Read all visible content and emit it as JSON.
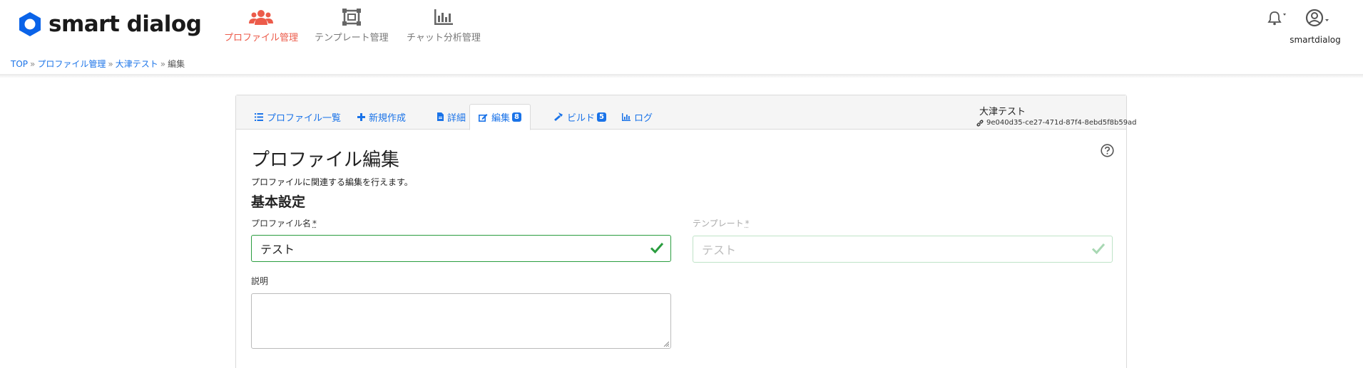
{
  "brand": {
    "name": "smart dialog",
    "color": "#0a63e8"
  },
  "nav": [
    {
      "label": "プロファイル管理",
      "icon": "users-icon",
      "active": true
    },
    {
      "label": "テンプレート管理",
      "icon": "template-frame-icon",
      "active": false
    },
    {
      "label": "チャット分析管理",
      "icon": "bar-chart-icon",
      "active": false
    }
  ],
  "user": {
    "name": "smartdialog",
    "icon": "user-circle-icon"
  },
  "notifications": {
    "icon": "bell-icon"
  },
  "breadcrumb": [
    "TOP",
    "プロファイル管理",
    "大津テスト",
    "編集"
  ],
  "tabs": [
    {
      "label": "プロファイル一覧",
      "icon": "list-icon"
    },
    {
      "label": "新規作成",
      "icon": "plus-icon"
    },
    {
      "label": "詳細",
      "icon": "file-icon"
    },
    {
      "label": "編集",
      "icon": "edit-icon",
      "badge": "8",
      "active": true
    },
    {
      "label": "ビルド",
      "icon": "hammer-icon",
      "badge": "5"
    },
    {
      "label": "ログ",
      "icon": "chart-icon"
    }
  ],
  "record": {
    "name": "大津テスト",
    "id": "9e040d35-ce27-471d-87f4-8ebd5f8b59ad",
    "icon": "link-icon"
  },
  "page": {
    "title": "プロファイル編集",
    "description": "プロファイルに関連する編集を行えます。",
    "section": "基本設定"
  },
  "form": {
    "profile_name": {
      "label": "プロファイル名",
      "required": "*",
      "value": "テスト"
    },
    "template": {
      "label": "テンプレート",
      "required": "*",
      "value": "テスト"
    },
    "description": {
      "label": "説明",
      "value": ""
    }
  },
  "colors": {
    "accent": "#ec5b4a",
    "link": "#1a73e8",
    "valid": "#2a9d3f"
  }
}
